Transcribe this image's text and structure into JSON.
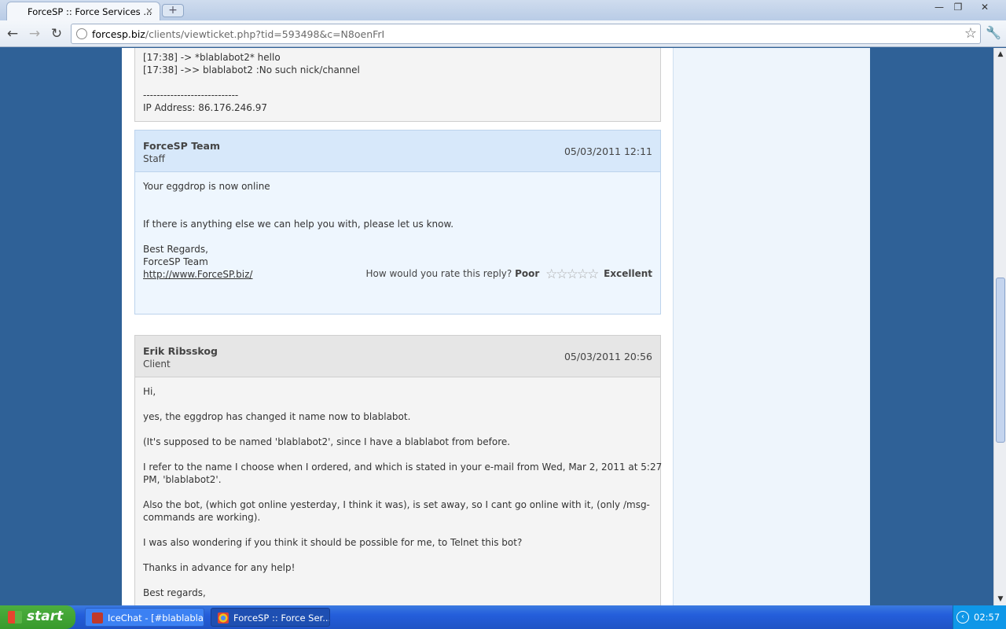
{
  "browser": {
    "tab_title": "ForceSP :: Force Services ...",
    "tab_close": "×",
    "new_tab": "+",
    "url_domain": "forcesp.biz",
    "url_path": "/clients/viewticket.php?tid=593498&c=N8oenFrI",
    "star": "☆",
    "back": "←",
    "forward": "→",
    "reload": "↻",
    "wrench": "🔧",
    "minimize": "—",
    "restore": "❐",
    "close": "✕"
  },
  "previous_message": {
    "lines": [
      "[17:38] -> *blablabot2* hello",
      "[17:38] ->> blablabot2 :No such nick/channel",
      "",
      "----------------------------",
      "IP Address: 86.176.246.97"
    ]
  },
  "staff_reply": {
    "author": "ForceSP Team",
    "role": "Staff",
    "date": "05/03/2011 12:11",
    "lines": [
      "Your eggdrop is now online",
      "",
      "",
      "If there is anything else we can help you with, please let us know.",
      "",
      "Best Regards,",
      "ForceSP Team"
    ],
    "link": "http://www.ForceSP.biz/",
    "rating_prompt": "How would you rate this reply?",
    "rating_low": "Poor",
    "rating_high": "Excellent",
    "rating_stars": "☆☆☆☆☆"
  },
  "client_reply": {
    "author": "Erik Ribsskog",
    "role": "Client",
    "date": "05/03/2011 20:56",
    "lines": [
      "Hi,",
      "",
      "yes, the eggdrop has changed it name now to blablabot.",
      "",
      "(It's supposed to be named 'blablabot2', since I have a blablabot from before.",
      "",
      "I refer to the name I choose when I ordered, and which is stated in your e-mail from Wed, Mar 2, 2011 at 5:27",
      "PM, 'blablabot2'.",
      "",
      "Also the bot, (which got online yesterday, I think it was), is set away, so I cant go online with it, (only /msg-",
      "commands are working).",
      "",
      "I was also wondering if you think it should be possible for me, to Telnet this bot?",
      "",
      "Thanks in advance for any help!",
      "",
      "Best regards,"
    ]
  },
  "scrollbar": {
    "up": "▲",
    "down": "▼"
  },
  "taskbar": {
    "start_label": "start",
    "tasks": [
      {
        "label": "IceChat - [#blablabla..."
      },
      {
        "label": "ForceSP :: Force Ser..."
      }
    ],
    "clock": "02:57",
    "tray_chevron": "‹"
  },
  "colors": {
    "page_background": "#2f6197",
    "staff_header": "#d7e8fa",
    "client_header": "#e6e6e6"
  }
}
